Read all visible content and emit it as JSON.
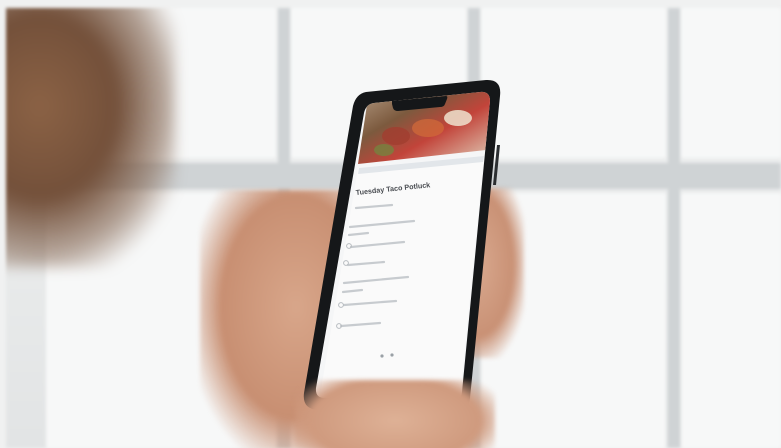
{
  "image": {
    "scene": "hand holding a smartphone in front of a bright window"
  },
  "phone_screen": {
    "form_title": "Tuesday Taco Potluck",
    "colors": {
      "screen": "#f5f6f7",
      "bezel": "#151719",
      "skin": "#d3a083",
      "hair": "#7a563f"
    }
  }
}
